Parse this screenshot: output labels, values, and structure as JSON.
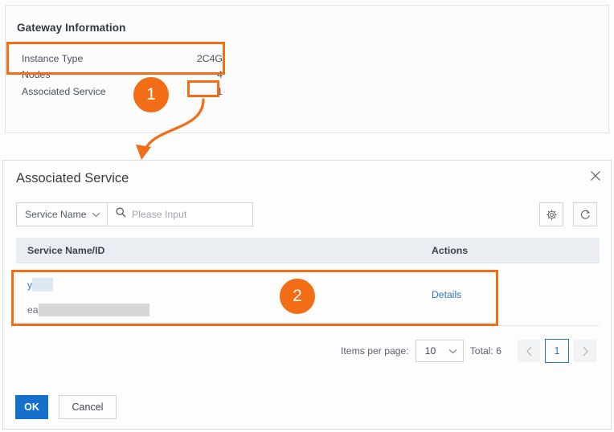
{
  "gateway_panel": {
    "title": "Gateway Information",
    "rows": [
      {
        "key": "Instance Type",
        "value": "2C4G"
      },
      {
        "key": "Nodes",
        "value": "4"
      },
      {
        "key": "Associated Service",
        "value": "1"
      }
    ]
  },
  "dialog": {
    "title": "Associated Service",
    "close_icon": "close-icon",
    "search": {
      "field_selector": "Service Name",
      "chevron_icon": "chevron-down-icon",
      "search_icon": "search-icon",
      "placeholder": "Please Input",
      "value": ""
    },
    "toolbar": {
      "settings_icon": "gear-icon",
      "refresh_icon": "refresh-icon"
    },
    "table": {
      "columns": [
        "Service Name/ID",
        "Actions"
      ],
      "rows": [
        {
          "name_prefix": "y",
          "name_redacted": true,
          "id_prefix": "ea",
          "id_redacted": true,
          "action": "Details"
        }
      ]
    },
    "pagination": {
      "items_per_page_label": "Items per page:",
      "page_size": "10",
      "page_size_chevron": "chevron-down-icon",
      "total_label": "Total: 6",
      "prev_icon": "chevron-left-icon",
      "next_icon": "chevron-right-icon",
      "current_page": "1"
    },
    "footer": {
      "ok_label": "OK",
      "cancel_label": "Cancel"
    }
  },
  "annotations": {
    "badge_1": "1",
    "badge_2": "2",
    "accent_color": "#f26d16"
  }
}
